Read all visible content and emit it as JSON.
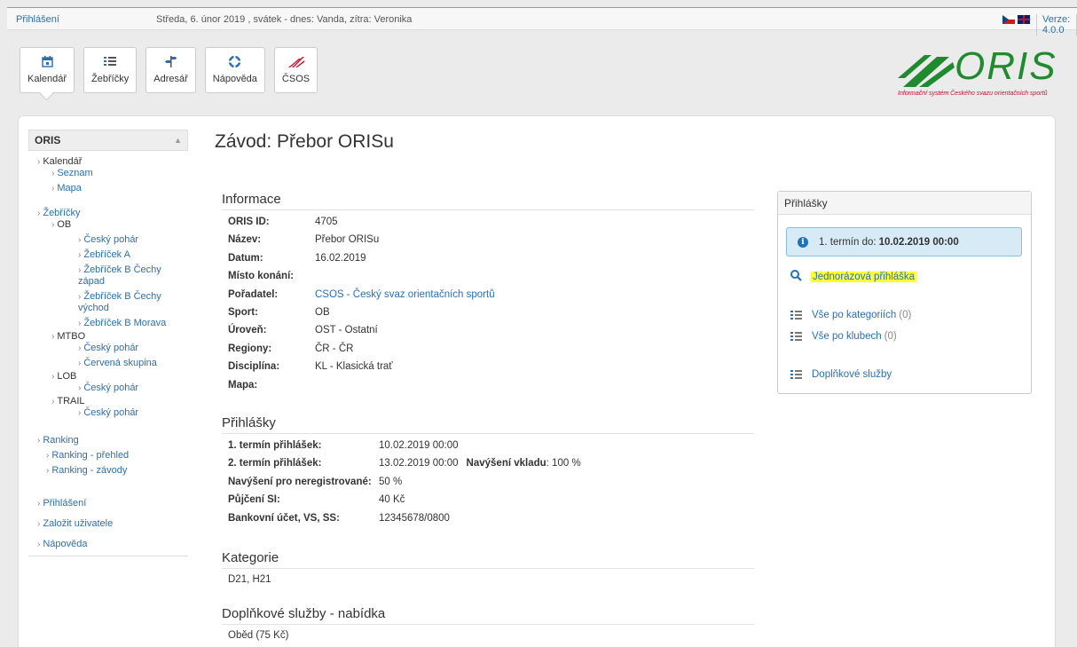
{
  "topbar": {
    "login": "Přihlášení",
    "date_text": "Středa, 6. únor 2019 , svátek - dnes: Vanda, zítra: Veronika",
    "version": "Verze: 4.0.0"
  },
  "toolbar": [
    {
      "icon": "calendar-icon",
      "label": "Kalendář"
    },
    {
      "icon": "list-icon",
      "label": "Žebříčky"
    },
    {
      "icon": "signpost-icon",
      "label": "Adresář"
    },
    {
      "icon": "lifebuoy-icon",
      "label": "Nápověda"
    },
    {
      "icon": "csos-logo-icon",
      "label": "ČSOS"
    }
  ],
  "logo": {
    "text": "ORIS",
    "subtitle": "Informační systém Českého svazu orientačních sportů"
  },
  "sidebar": {
    "header": "ORIS",
    "kalendar": "Kalendář",
    "seznam": "Seznam",
    "mapa": "Mapa",
    "zebricky": "Žebříčky",
    "ob": "OB",
    "ob_items": [
      "Český pohár",
      "Žebříček A",
      "Žebříček B Čechy západ",
      "Žebříček B Čechy východ",
      "Žebříček B Morava"
    ],
    "mtbo": "MTBO",
    "mtbo_items": [
      "Český pohár",
      "Červená skupina"
    ],
    "lob": "LOB",
    "lob_items": [
      "Český pohár"
    ],
    "trail": "TRAIL",
    "trail_items": [
      "Český pohár"
    ],
    "ranking": "Ranking",
    "ranking_items": [
      "Ranking - přehled",
      "Ranking - závody"
    ],
    "bottom": [
      "Přihlášení",
      "Založit uživatele",
      "Nápověda"
    ]
  },
  "main": {
    "title": "Závod: Přebor ORISu",
    "info_heading": "Informace",
    "info": [
      {
        "k": "ORIS ID:",
        "v": "4705"
      },
      {
        "k": "Název:",
        "v": "Přebor ORISu"
      },
      {
        "k": "Datum:",
        "v": "16.02.2019"
      },
      {
        "k": "Místo konání:",
        "v": ""
      },
      {
        "k": "Pořadatel:",
        "v": "CSOS - Český svaz orientačních sportů",
        "link": true
      },
      {
        "k": "Sport:",
        "v": "OB"
      },
      {
        "k": "Úroveň:",
        "v": "OST - Ostatní"
      },
      {
        "k": "Regiony:",
        "v": "ČR - ČR"
      },
      {
        "k": "Disciplína:",
        "v": "KL - Klasická trať"
      },
      {
        "k": "Mapa:",
        "v": ""
      }
    ],
    "reg_heading": "Přihlášky",
    "reg": [
      {
        "k": "1. termín přihlášek:",
        "v": "10.02.2019 00:00"
      },
      {
        "k": "2. termín přihlášek:",
        "v": "13.02.2019 00:00",
        "extra_k": "Navýšení vkladu",
        "extra_v": ": 100 %"
      },
      {
        "k": "Navýšení pro neregistrované:",
        "v": "50 %"
      },
      {
        "k": "Půjčení SI:",
        "v": "40 Kč"
      },
      {
        "k": "Bankovní účet, VS, SS:",
        "v": "12345678/0800"
      }
    ],
    "cat_heading": "Kategorie",
    "categories": "D21, H21",
    "services_heading": "Doplňkové služby - nabídka",
    "services": "Oběd (75 Kč)"
  },
  "reg_box": {
    "title": "Přihlášky",
    "deadline_label": "1. termín do: ",
    "deadline_value": "10.02.2019 00:00",
    "single_entry": "Jednorázová přihláška",
    "by_category": "Vše po kategoriích",
    "by_category_count": "(0)",
    "by_club": "Vše po klubech",
    "by_club_count": "(0)",
    "services": "Doplňkové služby"
  },
  "colors": {
    "link": "#2a6fb5",
    "logo_green": "#1f8a2e",
    "highlight": "#ffff33",
    "info_bg": "#d6ebf5"
  }
}
